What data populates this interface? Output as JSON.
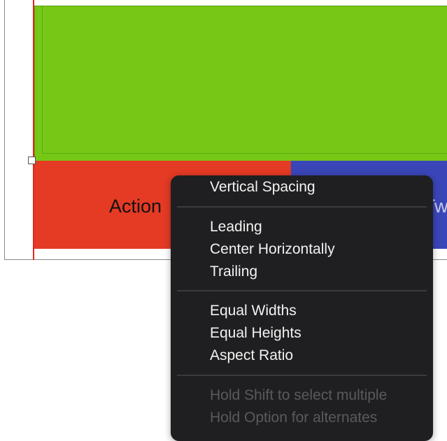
{
  "canvas": {
    "action_button_label": "Action",
    "action_two_button_label": "Action Two"
  },
  "context_menu": {
    "items": [
      {
        "label": "Vertical Spacing",
        "enabled": true
      },
      {
        "label": "Leading",
        "enabled": true
      },
      {
        "label": "Center Horizontally",
        "enabled": true
      },
      {
        "label": "Trailing",
        "enabled": true
      },
      {
        "label": "Equal Widths",
        "enabled": true
      },
      {
        "label": "Equal Heights",
        "enabled": true
      },
      {
        "label": "Aspect Ratio",
        "enabled": true
      }
    ],
    "hints": [
      "Hold Shift to select multiple",
      "Hold Option for alternates"
    ]
  },
  "colors": {
    "green_view": "#77c716",
    "action_button": "#e53a24",
    "action_two_button": "#3a46b8",
    "menu_background": "#1f1f21"
  }
}
